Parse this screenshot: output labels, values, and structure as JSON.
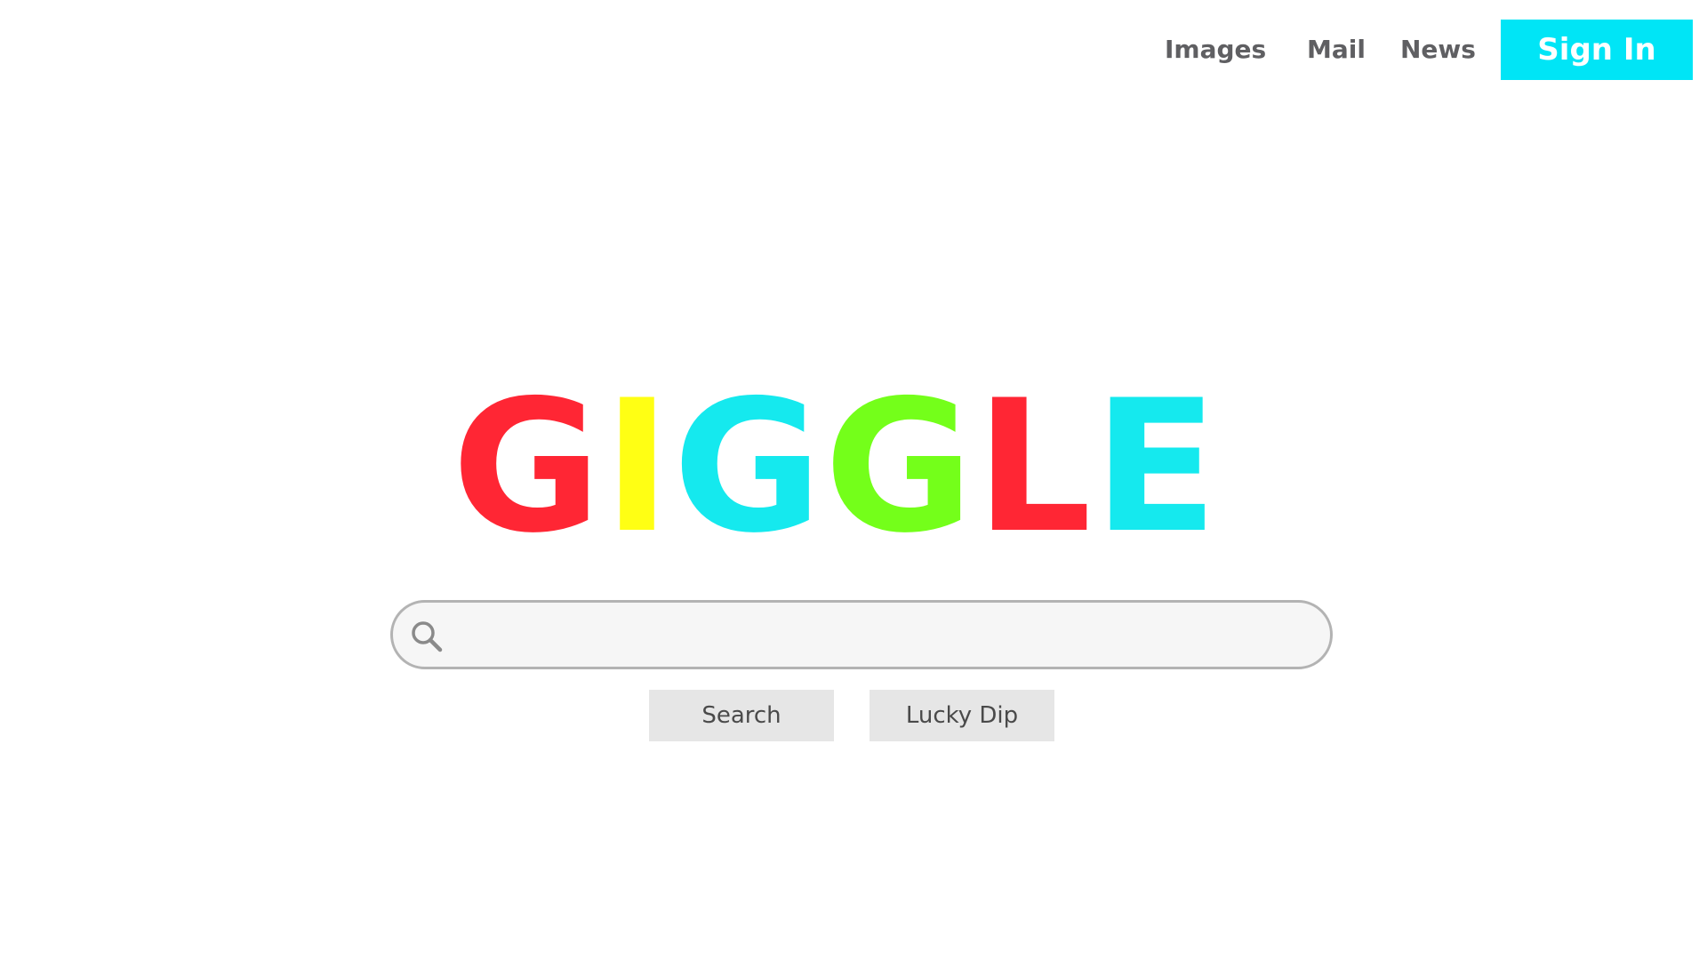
{
  "nav": {
    "images": "Images",
    "mail": "Mail",
    "news": "News",
    "sign_in": "Sign In"
  },
  "logo": {
    "letters": [
      {
        "char": "G",
        "color": "#ff2634"
      },
      {
        "char": "I",
        "color": "#ffff14"
      },
      {
        "char": "G",
        "color": "#15e9ee"
      },
      {
        "char": "G",
        "color": "#74ff1a"
      },
      {
        "char": "L",
        "color": "#ff2634"
      },
      {
        "char": "E",
        "color": "#15e9ee"
      }
    ]
  },
  "search": {
    "value": "",
    "placeholder": "",
    "icon": "search-icon"
  },
  "buttons": {
    "search": "Search",
    "lucky": "Lucky Dip"
  },
  "colors": {
    "accent": "#00e5f6",
    "nav_text": "#5f5f62",
    "button_bg": "#e6e6e6"
  }
}
